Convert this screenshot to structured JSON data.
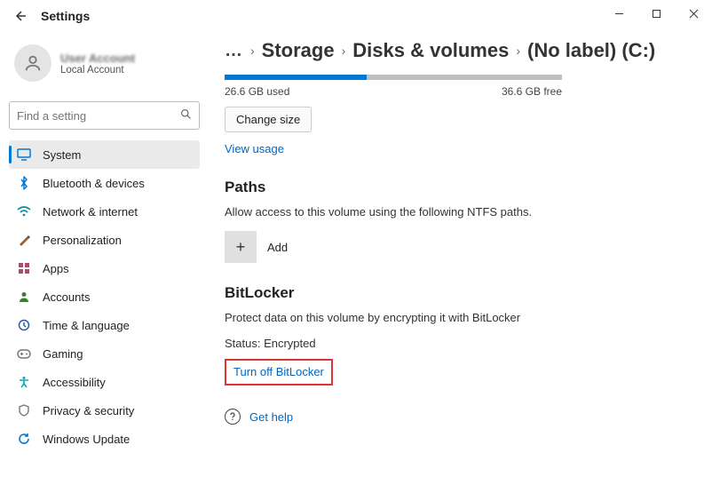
{
  "window": {
    "title": "Settings"
  },
  "account": {
    "name": "User Account",
    "subtitle": "Local Account"
  },
  "search": {
    "placeholder": "Find a setting"
  },
  "sidebar": {
    "items": [
      {
        "label": "System"
      },
      {
        "label": "Bluetooth & devices"
      },
      {
        "label": "Network & internet"
      },
      {
        "label": "Personalization"
      },
      {
        "label": "Apps"
      },
      {
        "label": "Accounts"
      },
      {
        "label": "Time & language"
      },
      {
        "label": "Gaming"
      },
      {
        "label": "Accessibility"
      },
      {
        "label": "Privacy & security"
      },
      {
        "label": "Windows Update"
      }
    ]
  },
  "breadcrumb": {
    "overflow": "…",
    "items": [
      "Storage",
      "Disks & volumes",
      "(No label) (C:)"
    ]
  },
  "storage": {
    "used_label": "26.6 GB used",
    "free_label": "36.6 GB free",
    "fill_percent": 42,
    "change_size_label": "Change size",
    "view_usage_label": "View usage"
  },
  "paths": {
    "heading": "Paths",
    "description": "Allow access to this volume using the following NTFS paths.",
    "add_label": "Add",
    "plus": "+"
  },
  "bitlocker": {
    "heading": "BitLocker",
    "description": "Protect data on this volume by encrypting it with BitLocker",
    "status": "Status: Encrypted",
    "turn_off_label": "Turn off BitLocker"
  },
  "help": {
    "label": "Get help"
  }
}
